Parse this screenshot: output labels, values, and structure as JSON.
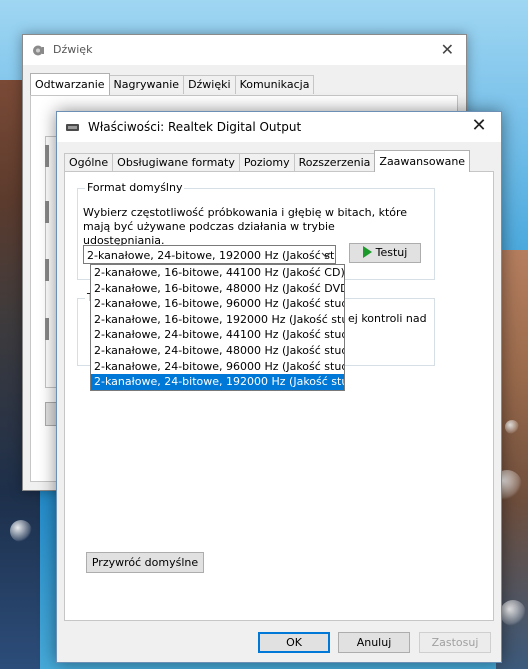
{
  "back_window": {
    "title": "Dźwięk",
    "close_glyph": "✕",
    "tabs": [
      {
        "label": "Odtwarzanie",
        "active": true
      },
      {
        "label": "Nagrywanie",
        "active": false
      },
      {
        "label": "Dźwięki",
        "active": false
      },
      {
        "label": "Komunikacja",
        "active": false
      }
    ]
  },
  "front_window": {
    "title": "Właściwości: Realtek Digital Output",
    "close_glyph": "✕",
    "tabs": [
      {
        "label": "Ogólne",
        "active": false
      },
      {
        "label": "Obsługiwane formaty",
        "active": false
      },
      {
        "label": "Poziomy",
        "active": false
      },
      {
        "label": "Rozszerzenia",
        "active": false
      },
      {
        "label": "Zaawansowane",
        "active": true
      }
    ],
    "format_group": {
      "legend": "Format domyślny",
      "description": "Wybierz częstotliwość próbkowania i głębię w bitach, które mają być używane podczas działania w trybie udostępniania.",
      "selected_value": "2-kanałowe, 24-bitowe, 192000 Hz (Jakość st",
      "test_button": "Testuj"
    },
    "dropdown_options": [
      "2-kanałowe, 16-bitowe, 44100 Hz (Jakość CD)",
      "2-kanałowe, 16-bitowe, 48000 Hz (Jakość DVD)",
      "2-kanałowe, 16-bitowe, 96000 Hz (Jakość studyjn",
      "2-kanałowe, 16-bitowe, 192000 Hz (Jakość studyj",
      "2-kanałowe, 24-bitowe, 44100 Hz (Jakość studyjn",
      "2-kanałowe, 24-bitowe, 48000 Hz (Jakość studyjn",
      "2-kanałowe, 24-bitowe, 96000 Hz (Jakość studyjn",
      "2-kanałowe, 24-bitowe, 192000 Hz (Jakość studyj"
    ],
    "dropdown_selected_index": 7,
    "exclusive_group": {
      "partial_legend": "T",
      "partial_text": "ej kontroli nad"
    },
    "restore_button": "Przywróć domyślne",
    "buttons": {
      "ok": "OK",
      "cancel": "Anuluj",
      "apply": "Zastosuj"
    }
  }
}
